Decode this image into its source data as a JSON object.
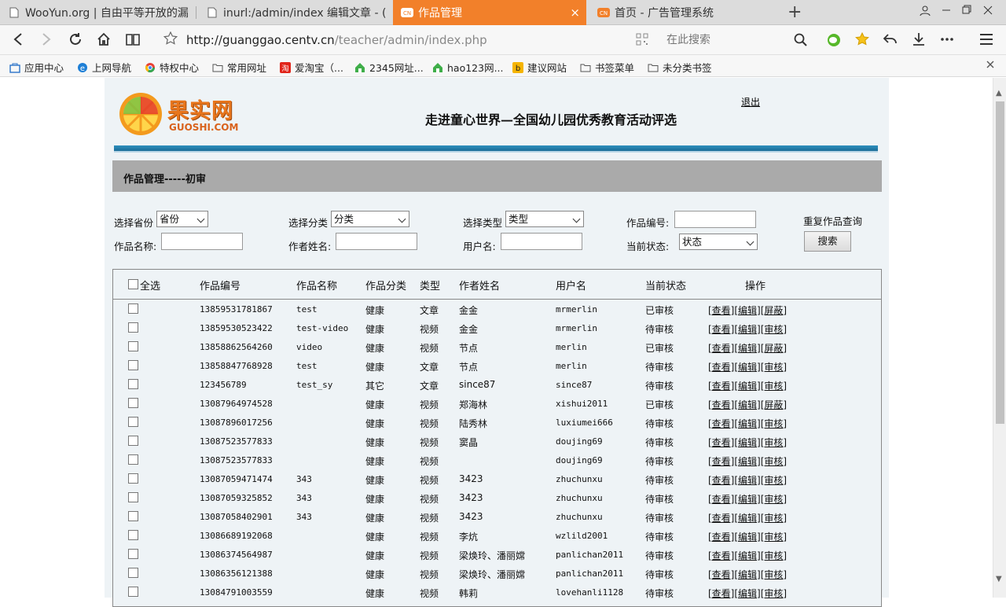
{
  "browser": {
    "tabs": [
      {
        "title": "WooYun.org | 自由平等开放的漏"
      },
      {
        "title": "inurl:/admin/index 编辑文章 - (",
        "close": "×"
      },
      {
        "title": "作品管理",
        "active": true,
        "close": "×"
      },
      {
        "title": "首页 - 广告管理系统"
      }
    ],
    "new_tab": "+",
    "url_host": "http://guanggao.centv.cn",
    "url_path": "/teacher/admin/index.php",
    "search_placeholder": "在此搜索",
    "bookmarks": [
      "应用中心",
      "上网导航",
      "特权中心",
      "常用网址",
      "爱淘宝（...",
      "2345网址...",
      "hao123网...",
      "建议网站",
      "书签菜单",
      "未分类书签"
    ],
    "accent_color": "#f2802a"
  },
  "header": {
    "logo_text": "果实网",
    "logo_sub": "GUOSHI.COM",
    "site_title": "走进童心世界—全国幼儿园优秀教育活动评选",
    "logout": "退出"
  },
  "section_title": "作品管理-----初审",
  "filters": {
    "province_label": "选择省份",
    "province_value": "省份",
    "category_label": "选择分类",
    "category_value": "分类",
    "type_label": "选择类型",
    "type_value": "类型",
    "work_no_label": "作品编号:",
    "duplicate_link": "重复作品查询",
    "work_name_label": "作品名称:",
    "author_label": "作者姓名:",
    "username_label": "用户名:",
    "status_label": "当前状态:",
    "status_value": "状态",
    "search_button": "搜索"
  },
  "table": {
    "headers": {
      "select_all": "全选",
      "no": "作品编号",
      "name": "作品名称",
      "category": "作品分类",
      "type": "类型",
      "author": "作者姓名",
      "user": "用户名",
      "status": "当前状态",
      "ops": "操作"
    },
    "op_view": "[查看]",
    "op_edit": "[编辑]",
    "rows": [
      {
        "no": "13859531781867",
        "name": "test",
        "category": "健康",
        "type": "文章",
        "author": "金金",
        "user": "mrmerlin",
        "status": "已审核",
        "op3": "[屏蔽]"
      },
      {
        "no": "13859530523422",
        "name": "test-video",
        "category": "健康",
        "type": "视频",
        "author": "金金",
        "user": "mrmerlin",
        "status": "待审核",
        "op3": "[审核]"
      },
      {
        "no": "13858862564260",
        "name": "video",
        "category": "健康",
        "type": "视频",
        "author": "节点",
        "user": "merlin",
        "status": "已审核",
        "op3": "[屏蔽]"
      },
      {
        "no": "13858847768928",
        "name": "test",
        "category": "健康",
        "type": "文章",
        "author": "节点",
        "user": "merlin",
        "status": "待审核",
        "op3": "[审核]"
      },
      {
        "no": "123456789",
        "name": "test_sy",
        "category": "其它",
        "type": "文章",
        "author": "since87",
        "user": "since87",
        "status": "待审核",
        "op3": "[审核]"
      },
      {
        "no": "13087964974528",
        "name": "",
        "category": "健康",
        "type": "视频",
        "author": "郑海林",
        "user": "xishui2011",
        "status": "已审核",
        "op3": "[屏蔽]"
      },
      {
        "no": "13087896017256",
        "name": "",
        "category": "健康",
        "type": "视频",
        "author": "陆秀林",
        "user": "luxiumei666",
        "status": "待审核",
        "op3": "[审核]"
      },
      {
        "no": "13087523577833",
        "name": "",
        "category": "健康",
        "type": "视频",
        "author": "窦晶",
        "user": "doujing69",
        "status": "待审核",
        "op3": "[审核]"
      },
      {
        "no": "13087523577833",
        "name": "",
        "category": "健康",
        "type": "视频",
        "author": "",
        "user": "doujing69",
        "status": "待审核",
        "op3": "[审核]"
      },
      {
        "no": "13087059471474",
        "name": "343",
        "category": "健康",
        "type": "视频",
        "author": "3423",
        "user": "zhuchunxu",
        "status": "待审核",
        "op3": "[审核]"
      },
      {
        "no": "13087059325852",
        "name": "343",
        "category": "健康",
        "type": "视频",
        "author": "3423",
        "user": "zhuchunxu",
        "status": "待审核",
        "op3": "[审核]"
      },
      {
        "no": "13087058402901",
        "name": "343",
        "category": "健康",
        "type": "视频",
        "author": "3423",
        "user": "zhuchunxu",
        "status": "待审核",
        "op3": "[审核]"
      },
      {
        "no": "13086689192068",
        "name": "",
        "category": "健康",
        "type": "视频",
        "author": "李炕",
        "user": "wzlild2001",
        "status": "待审核",
        "op3": "[审核]"
      },
      {
        "no": "13086374564987",
        "name": "",
        "category": "健康",
        "type": "视频",
        "author": "梁焕玲、潘丽嫦",
        "user": "panlichan2011",
        "status": "待审核",
        "op3": "[审核]"
      },
      {
        "no": "13086356121388",
        "name": "",
        "category": "健康",
        "type": "视频",
        "author": "梁焕玲、潘丽嫦",
        "user": "panlichan2011",
        "status": "待审核",
        "op3": "[审核]"
      },
      {
        "no": "13084791003559",
        "name": "",
        "category": "健康",
        "type": "视频",
        "author": "韩莉",
        "user": "lovehanli1128",
        "status": "待审核",
        "op3": "[审核]"
      }
    ]
  }
}
